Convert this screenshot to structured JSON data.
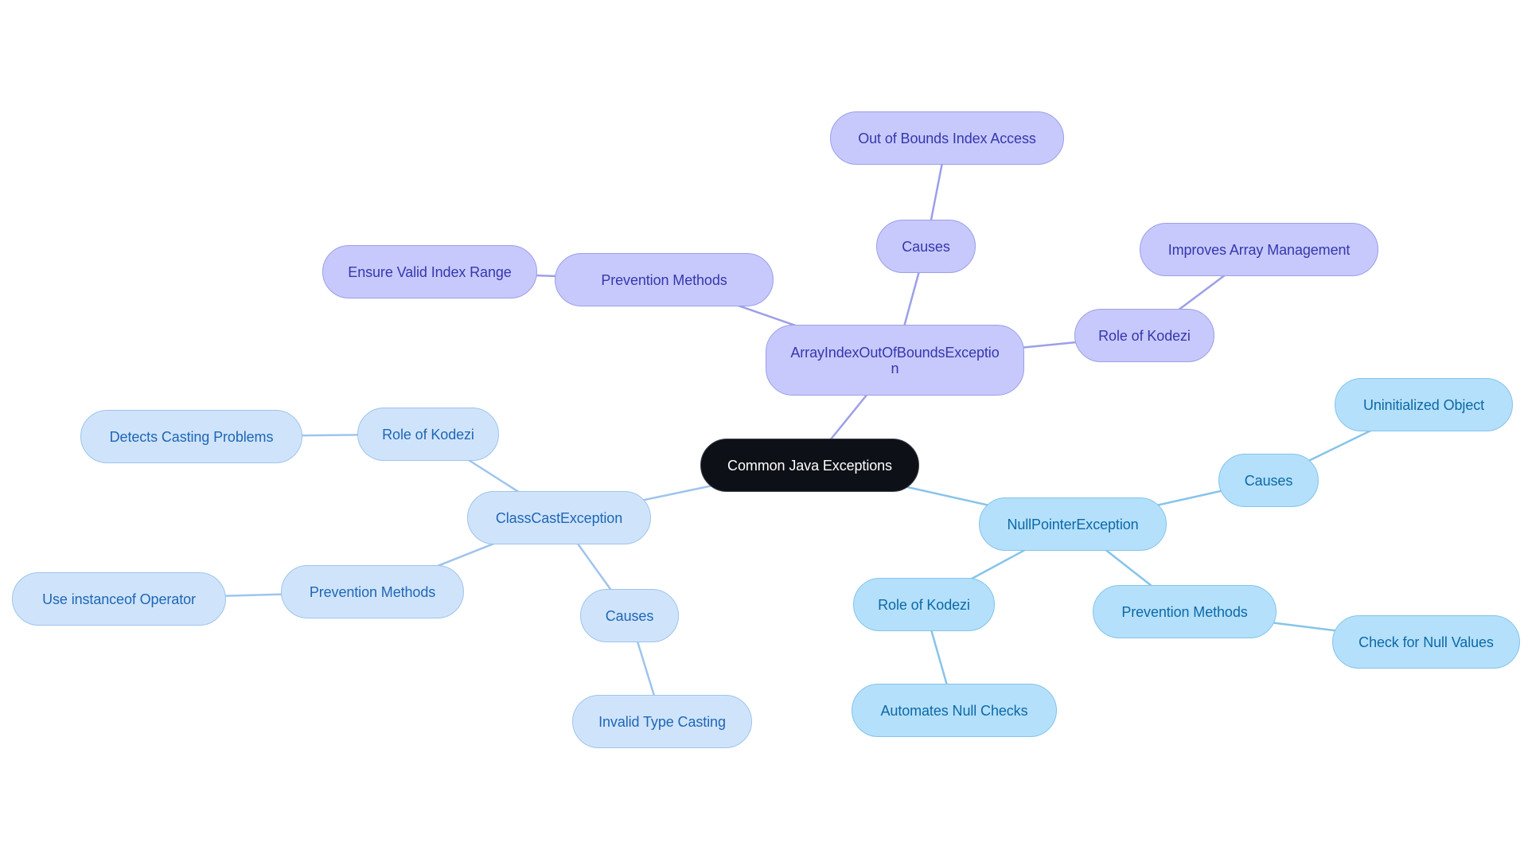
{
  "diagram": {
    "type": "mind-map",
    "colors": {
      "root_fill": "#0d1117",
      "root_text": "#ffffff",
      "array_branch_fill": "#c7c9fc",
      "array_branch_text": "#3537ad",
      "array_branch_edge": "#9c9fe8",
      "cast_branch_fill": "#cfe4fb",
      "cast_branch_text": "#1f66b6",
      "cast_branch_edge": "#9fc4ec",
      "npe_branch_fill": "#b4e0fc",
      "npe_branch_text": "#0d69a6",
      "npe_branch_edge": "#86c4ea"
    },
    "root": {
      "label": "Common Java Exceptions"
    },
    "branches": {
      "array": {
        "label": "ArrayIndexOutOfBoundsException",
        "causes": {
          "label": "Causes",
          "child": "Out of Bounds Index Access"
        },
        "prevention": {
          "label": "Prevention Methods",
          "child": "Ensure Valid Index Range"
        },
        "role": {
          "label": "Role of Kodezi",
          "child": "Improves Array Management"
        }
      },
      "cast": {
        "label": "ClassCastException",
        "role": {
          "label": "Role of Kodezi",
          "child": "Detects Casting Problems"
        },
        "prevention": {
          "label": "Prevention Methods",
          "child": "Use instanceof Operator"
        },
        "causes": {
          "label": "Causes",
          "child": "Invalid Type Casting"
        }
      },
      "npe": {
        "label": "NullPointerException",
        "causes": {
          "label": "Causes",
          "child": "Uninitialized Object"
        },
        "role": {
          "label": "Role of Kodezi",
          "child": "Automates Null Checks"
        },
        "prevention": {
          "label": "Prevention Methods",
          "child": "Check for Null Values"
        }
      }
    },
    "edges": [
      [
        "n-root",
        "n-array",
        "array"
      ],
      [
        "n-array",
        "n-a-causes",
        "array"
      ],
      [
        "n-a-causes",
        "n-a-oob",
        "array"
      ],
      [
        "n-array",
        "n-a-prev",
        "array"
      ],
      [
        "n-a-prev",
        "n-a-valid",
        "array"
      ],
      [
        "n-array",
        "n-a-role",
        "array"
      ],
      [
        "n-a-role",
        "n-a-improve",
        "array"
      ],
      [
        "n-root",
        "n-cast",
        "cast"
      ],
      [
        "n-cast",
        "n-c-role",
        "cast"
      ],
      [
        "n-c-role",
        "n-c-detect",
        "cast"
      ],
      [
        "n-cast",
        "n-c-prev",
        "cast"
      ],
      [
        "n-c-prev",
        "n-c-inst",
        "cast"
      ],
      [
        "n-cast",
        "n-c-causes",
        "cast"
      ],
      [
        "n-c-causes",
        "n-c-invalid",
        "cast"
      ],
      [
        "n-root",
        "n-npe",
        "npe"
      ],
      [
        "n-npe",
        "n-p-causes",
        "npe"
      ],
      [
        "n-p-causes",
        "n-p-uninit",
        "npe"
      ],
      [
        "n-npe",
        "n-p-role",
        "npe"
      ],
      [
        "n-p-role",
        "n-p-auto",
        "npe"
      ],
      [
        "n-npe",
        "n-p-prev",
        "npe"
      ],
      [
        "n-p-prev",
        "n-p-check",
        "npe"
      ]
    ]
  }
}
